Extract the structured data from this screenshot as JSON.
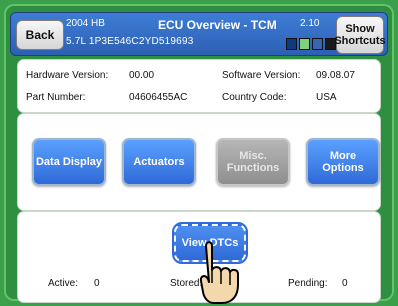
{
  "header": {
    "back_label": "Back",
    "model_line1": "2004 HB",
    "model_line2": "5.7L   1P3E546C2YD519693",
    "title": "ECU Overview - TCM",
    "version": "2.10",
    "show_shortcuts_label": "Show Shortcuts",
    "status_icons": [
      "status-icon-a",
      "status-icon-b",
      "status-icon-c",
      "status-icon-d"
    ]
  },
  "info": {
    "hardware_label": "Hardware Version:",
    "hardware_value": "00.00",
    "software_label": "Software Version:",
    "software_value": "09.08.07",
    "part_label": "Part Number:",
    "part_value": "04606455AC",
    "country_label": "Country Code:",
    "country_value": "USA"
  },
  "actions": {
    "data_display": "Data Display",
    "actuators": "Actuators",
    "misc_functions": "Misc. Functions",
    "more_options": "More Options"
  },
  "dtcs": {
    "view_dtcs": "View DTCs",
    "active_label": "Active:",
    "active_value": "0",
    "stored_label": "Stored:",
    "stored_value": "",
    "pending_label": "Pending:",
    "pending_value": "0"
  },
  "colors": {
    "background": "#3aa14a",
    "header_blue": "#2c5fb2",
    "button_blue": "#2f6ad8",
    "button_disabled": "#9a9a9a"
  }
}
